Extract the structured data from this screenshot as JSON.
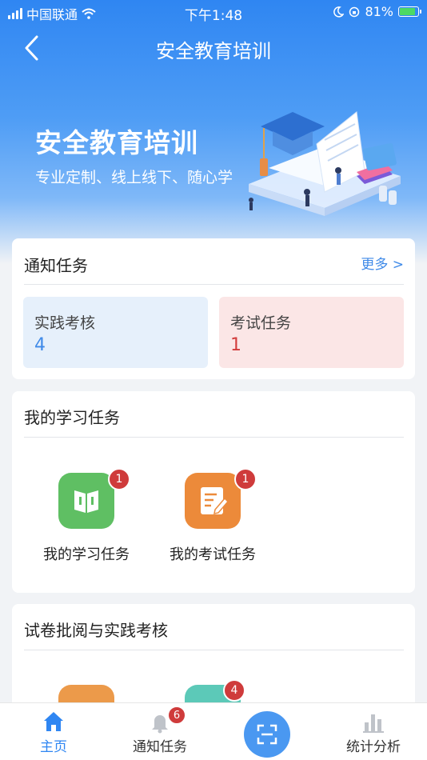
{
  "status_bar": {
    "carrier": "中国联通",
    "time": "下午1:48",
    "battery": "81%"
  },
  "header": {
    "title": "安全教育培训"
  },
  "banner": {
    "title": "安全教育培训",
    "subtitle": "专业定制、线上线下、随心学"
  },
  "notice_card": {
    "title": "通知任务",
    "more": "更多 >",
    "stats": [
      {
        "label": "实践考核",
        "value": "4",
        "color": "#3f8ae8",
        "bg": "#e6f0fb"
      },
      {
        "label": "考试任务",
        "value": "1",
        "color": "#d23c3c",
        "bg": "#fbe6e6"
      }
    ]
  },
  "study_card": {
    "title": "我的学习任务",
    "apps": [
      {
        "label": "我的学习任务",
        "badge": "1",
        "icon": "book-icon",
        "color": "#5fbf63"
      },
      {
        "label": "我的考试任务",
        "badge": "1",
        "icon": "exam-edit-icon",
        "color": "#ec8a3a"
      }
    ]
  },
  "review_card": {
    "title": "试卷批阅与实践考核",
    "apps": [
      {
        "badge": "",
        "icon": "orange-app-icon",
        "color": "#ec9a4a"
      },
      {
        "badge": "4",
        "icon": "teal-app-icon",
        "color": "#5cc9b8"
      }
    ]
  },
  "tabbar": {
    "items": [
      {
        "label": "主页",
        "icon": "home-icon"
      },
      {
        "label": "通知任务",
        "icon": "bell-icon",
        "badge": "6"
      },
      {
        "label": "",
        "icon": "scan-icon"
      },
      {
        "label": "统计分析",
        "icon": "bar-chart-icon"
      }
    ],
    "active_color": "#2f86f2"
  }
}
